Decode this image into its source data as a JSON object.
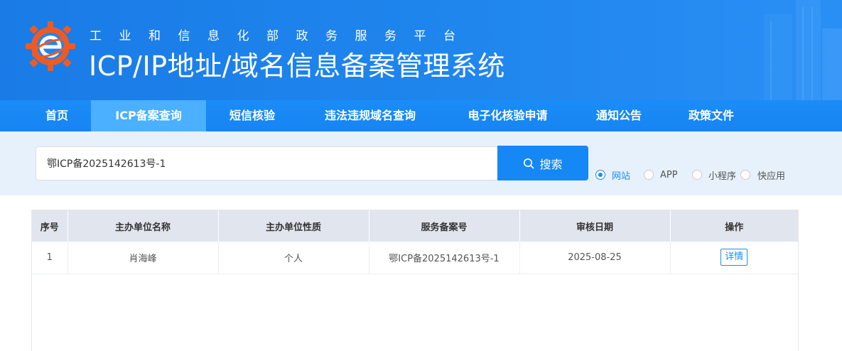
{
  "header": {
    "subtitle": "工业和信息化部政务服务平台",
    "title": "ICP/IP地址/域名信息备案管理系统"
  },
  "nav": {
    "items": [
      {
        "label": "首页"
      },
      {
        "label": "ICP备案查询"
      },
      {
        "label": "短信核验"
      },
      {
        "label": "违法违规域名查询"
      },
      {
        "label": "电子化核验申请"
      },
      {
        "label": "通知公告"
      },
      {
        "label": "政策文件"
      }
    ],
    "active": "ICP备案查询"
  },
  "search": {
    "value": "鄂ICP备2025142613号-1",
    "button_label": "搜索",
    "options": [
      {
        "label": "网站",
        "checked": true
      },
      {
        "label": "APP",
        "checked": false
      },
      {
        "label": "小程序",
        "checked": false
      },
      {
        "label": "快应用",
        "checked": false
      }
    ]
  },
  "table": {
    "headers": [
      "序号",
      "主办单位名称",
      "主办单位性质",
      "服务备案号",
      "审核日期",
      "操作"
    ],
    "rows": [
      {
        "index": "1",
        "org_name": "肖海峰",
        "org_type": "个人",
        "record_no": "鄂ICP备2025142613号-1",
        "date": "2025-08-25",
        "action": "详情"
      }
    ]
  },
  "colors": {
    "header_blue": "#1a7be6",
    "nav_blue": "#1a8cf8",
    "nav_active": "#4ab0ff",
    "search_bg": "#e6f1fc",
    "table_header_bg": "#e1e5ee"
  }
}
